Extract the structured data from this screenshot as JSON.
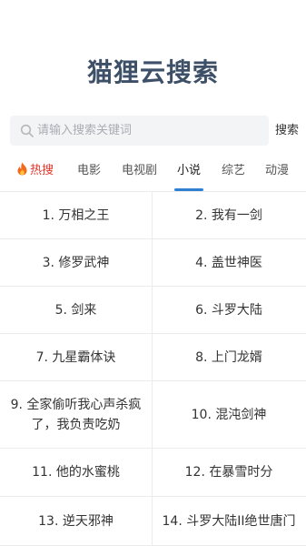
{
  "app": {
    "title": "猫狸云搜索"
  },
  "search": {
    "placeholder": "请输入搜索关键词",
    "value": "",
    "button_label": "搜索"
  },
  "tabs": [
    {
      "label": "热搜",
      "icon": "fire-icon"
    },
    {
      "label": "电影"
    },
    {
      "label": "电视剧"
    },
    {
      "label": "小说",
      "active": true
    },
    {
      "label": "综艺"
    },
    {
      "label": "动漫"
    }
  ],
  "colors": {
    "title": "#3d5068",
    "hot": "#e8352b",
    "active_underline": "#2f80d3"
  },
  "list": [
    "1. 万相之王",
    "2. 我有一剑",
    "3. 修罗武神",
    "4. 盖世神医",
    "5. 剑来",
    "6. 斗罗大陆",
    "7. 九星霸体诀",
    "8. 上门龙婿",
    "9. 全家偷听我心声杀疯了，我负责吃奶",
    "10. 混沌剑神",
    "11. 他的水蜜桃",
    "12. 在暴雪时分",
    "13. 逆天邪神",
    "14. 斗罗大陆II绝世唐门"
  ]
}
